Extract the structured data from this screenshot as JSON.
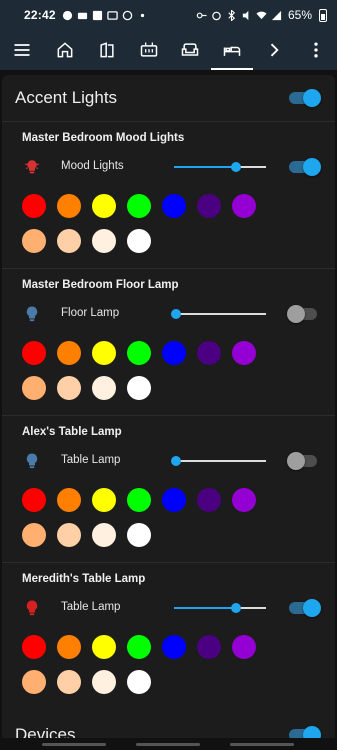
{
  "status": {
    "time": "22:42",
    "battery": "65%"
  },
  "toolbar": {
    "items": [
      {
        "icon": "menu-icon"
      },
      {
        "icon": "home-icon"
      },
      {
        "icon": "doors-icon"
      },
      {
        "icon": "heater-icon"
      },
      {
        "icon": "sofa-icon"
      },
      {
        "icon": "bed-icon",
        "active": true
      },
      {
        "icon": "chevron-right-icon"
      },
      {
        "icon": "more-vert-icon"
      }
    ]
  },
  "card": {
    "title": "Accent Lights",
    "toggle_on": true,
    "sections": [
      {
        "title": "Master Bedroom Mood Lights",
        "light_label": "Mood Lights",
        "icon": "mood-lights-icon",
        "icon_color": "#d63232",
        "brightness": 0.68,
        "on": true
      },
      {
        "title": "Master Bedroom Floor Lamp",
        "light_label": "Floor Lamp",
        "icon": "bulb-icon",
        "icon_color": "#4b7ba8",
        "brightness": 0.0,
        "on": false
      },
      {
        "title": "Alex's Table Lamp",
        "light_label": "Table Lamp",
        "icon": "bulb-icon",
        "icon_color": "#4b7ba8",
        "brightness": 0.0,
        "on": false
      },
      {
        "title": "Meredith's Table Lamp",
        "light_label": "Table Lamp",
        "icon": "bulb-icon",
        "icon_color": "#d92020",
        "brightness": 0.68,
        "on": true
      }
    ],
    "swatch_colors": [
      [
        "#ff0000",
        "#ff8000",
        "#ffff00",
        "#00ff00",
        "#0000ff",
        "#4b0082",
        "#9400d3"
      ],
      [
        "#ffb070",
        "#ffcfa8",
        "#fff0e0",
        "#ffffff"
      ]
    ]
  },
  "card2": {
    "title": "Devices",
    "toggle_on": true
  },
  "colors": {
    "accent": "#1ea7ef",
    "toolbar_bg": "#1e2b36",
    "card_bg": "#1c1c1c"
  }
}
